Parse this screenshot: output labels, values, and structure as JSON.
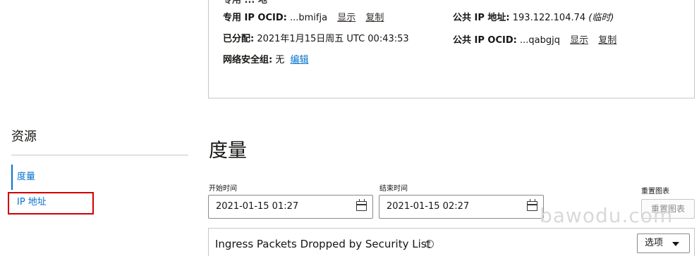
{
  "details": {
    "row0_left": "专用 ... 地",
    "private_ip_ocid_label": "专用 IP OCID:",
    "private_ip_ocid_value": "...bmifja",
    "show_label": "显示",
    "copy_label": "复制",
    "assigned_label": "已分配:",
    "assigned_value": "2021年1月15日周五 UTC 00:43:53",
    "nsg_label": "网络安全组:",
    "nsg_value": "无",
    "edit_label": "编辑",
    "public_ip_label": "公共 IP 地址:",
    "public_ip_value": "193.122.104.74",
    "public_ip_note": "(临时)",
    "public_ip_ocid_label": "公共 IP OCID:",
    "public_ip_ocid_value": "...qabgjq"
  },
  "sidebar": {
    "title": "资源",
    "items": [
      {
        "label": "度量",
        "active": true
      },
      {
        "label": "IP 地址",
        "active": false
      }
    ]
  },
  "metrics": {
    "title": "度量",
    "start_label": "开始时间",
    "start_value": "2021-01-15 01:27",
    "end_label": "结束时间",
    "end_value": "2021-01-15 02:27",
    "reset_label": "重置图表",
    "reset_button": "重置图表",
    "chart_title": "Ingress Packets Dropped by Security List",
    "info_glyph": "i",
    "options_label": "选项"
  },
  "watermark": "bawodu.com",
  "colors": {
    "link_blue": "#0572ce",
    "highlight_red": "#d00000",
    "border_gray": "#c7c7c7"
  }
}
